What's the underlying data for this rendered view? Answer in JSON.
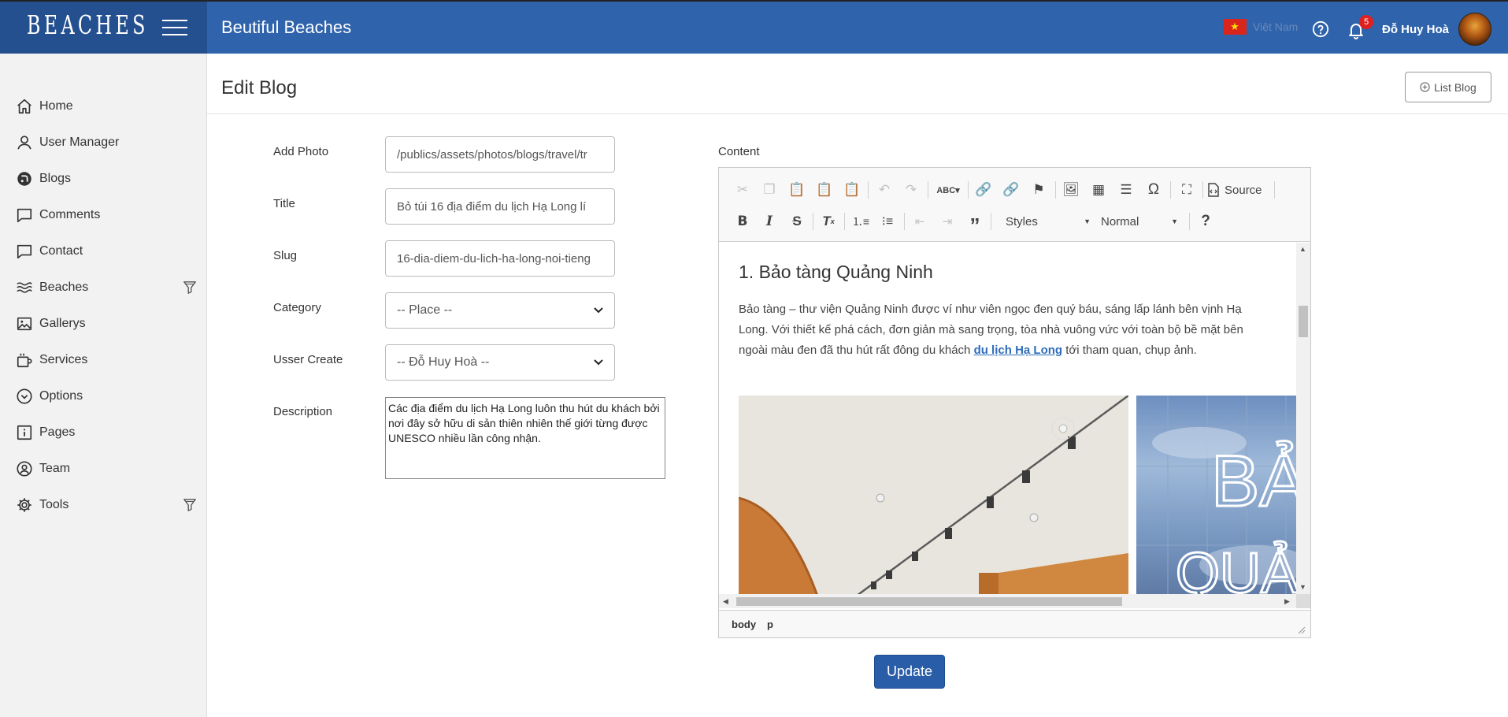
{
  "brand": {
    "logo": "BEACHES",
    "app_title": "Beutiful Beaches"
  },
  "header": {
    "language": "Việt Nam",
    "notification_count": "5",
    "user_name": "Đỗ Huy Hoà"
  },
  "sidebar": {
    "items": [
      {
        "label": "Home",
        "icon": "home-icon"
      },
      {
        "label": "User Manager",
        "icon": "user-icon"
      },
      {
        "label": "Blogs",
        "icon": "blog-icon"
      },
      {
        "label": "Comments",
        "icon": "comment-icon"
      },
      {
        "label": "Contact",
        "icon": "contact-icon"
      },
      {
        "label": "Beaches",
        "icon": "waves-icon",
        "filter": true
      },
      {
        "label": "Gallerys",
        "icon": "image-icon"
      },
      {
        "label": "Services",
        "icon": "services-icon"
      },
      {
        "label": "Options",
        "icon": "options-icon"
      },
      {
        "label": "Pages",
        "icon": "info-icon"
      },
      {
        "label": "Team",
        "icon": "team-icon"
      },
      {
        "label": "Tools",
        "icon": "gear-icon",
        "filter": true
      }
    ]
  },
  "page": {
    "title": "Edit Blog",
    "list_button": "List Blog"
  },
  "form": {
    "photo_label": "Add Photo",
    "photo_value": "/publics/assets/photos/blogs/travel/tr",
    "title_label": "Title",
    "title_value": "Bỏ túi 16 địa điểm du lịch Hạ Long lí",
    "slug_label": "Slug",
    "slug_value": "16-dia-diem-du-lich-ha-long-noi-tieng",
    "category_label": "Category",
    "category_value": "-- Place --",
    "user_label": "Usser Create",
    "user_value": "-- Đỗ Huy Hoà --",
    "description_label": "Description",
    "description_value": "Các địa điểm du lịch Hạ Long luôn thu hút du khách bởi nơi đây sở hữu di sản thiên nhiên thế giới từng được UNESCO nhiều lần công nhận."
  },
  "editor": {
    "label": "Content",
    "source_label": "Source",
    "styles_label": "Styles",
    "format_label": "Normal",
    "heading": "1. Bảo tàng Quảng Ninh",
    "para_before": "Bảo tàng – thư viện Quảng Ninh được ví như viên ngọc đen quý báu, sáng lấp lánh bên vịnh Hạ Long. Với thiết kế phá cách, đơn giản mà sang trọng, tòa nhà vuông vức với toàn bộ bề mặt bên ngoài màu đen đã thu hút rất đông du khách ",
    "para_link": "du lịch Hạ Long",
    "para_after": " tới tham quan, chụp ảnh.",
    "image2_text_1": "BẢ",
    "image2_text_2": "QUẢ",
    "path": [
      "body",
      "p"
    ]
  },
  "actions": {
    "update_label": "Update"
  }
}
